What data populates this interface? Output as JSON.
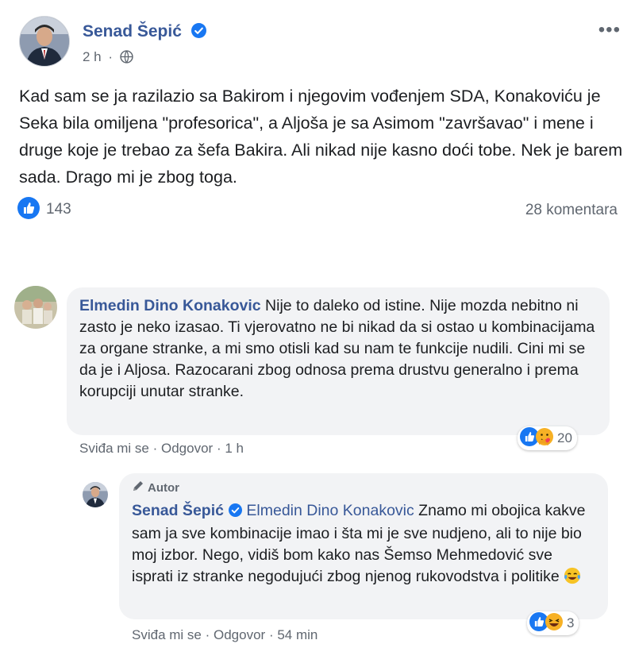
{
  "post": {
    "author": "Senad Šepić",
    "time": "2 h",
    "text": "Kad sam se ja razilazio sa Bakirom i njegovim vođenjem SDA, Konakoviću je Seka bila omiljena \"profesorica\", a Aljoša je sa Asimom \"završavao\" i mene i druge koje je trebao za šefa Bakira. Ali nikad nije kasno doći tobe. Nek je barem sada. Drago mi je zbog toga.",
    "reactions_count": "143",
    "comments_count": "28 komentara",
    "more": "•••"
  },
  "comment1": {
    "author": "Elmedin Dino Konakovic",
    "text": "Nije to daleko od istine. Nije mozda nebitno ni zasto je neko izasao. Ti vjerovatno ne bi nikad da si ostao u kombinacijama za organe stranke, a mi smo otisli kad su nam te funkcije nudili. Cini mi se da je i Aljosa. Razocarani zbog odnosa prema drustvu generalno i prema korupciji unutar stranke.",
    "like_label": "Sviđa mi se",
    "reply_label": "Odgovor",
    "time": "1 h",
    "reactions_count": "20"
  },
  "reply1": {
    "badge": "Autor",
    "author": "Senad Šepić",
    "mention": "Elmedin Dino Konakovic",
    "text": "Znamo mi obojica kakve sam ja sve kombinacije imao i šta mi je sve nudjeno, ali to nije bio moj izbor. Nego, vidiš bom kako nas Šemso Mehmedović sve isprati iz stranke negodujući zbog njenog rukovodstva i politike",
    "like_label": "Sviđa mi se",
    "reply_label": "Odgovor",
    "time": "54 min",
    "reactions_count": "3"
  },
  "colors": {
    "link": "#385898",
    "like_blue": "#1877f2",
    "bubble": "#f2f3f5",
    "meta": "#606770"
  },
  "icons": [
    "verified-badge-icon",
    "globe-icon",
    "like-icon",
    "haha-icon",
    "care-icon",
    "pencil-icon"
  ]
}
